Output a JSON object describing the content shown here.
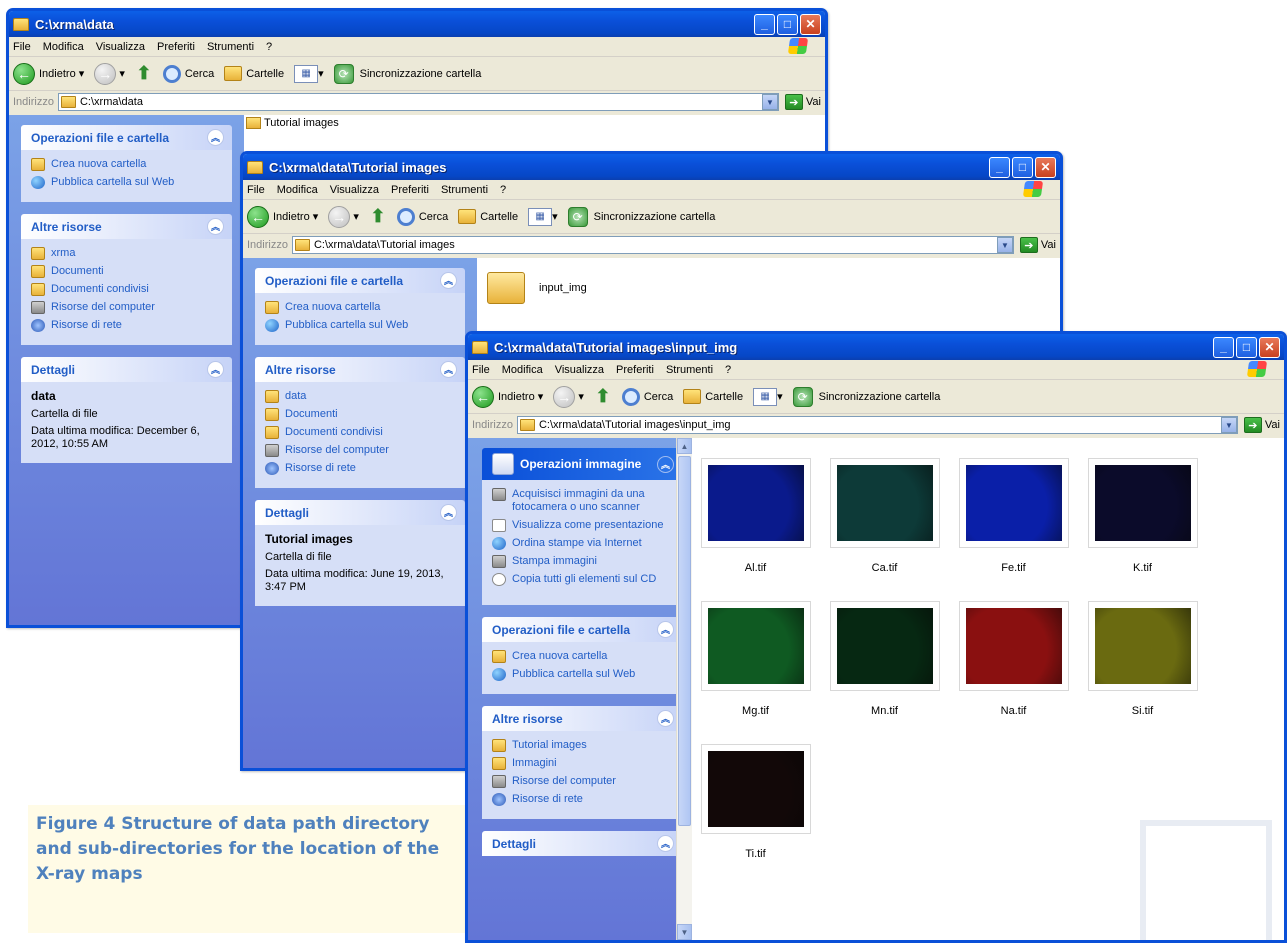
{
  "caption": "Figure 4 Structure of data path directory and sub-directories for the location of the X-ray maps",
  "menu": [
    "File",
    "Modifica",
    "Visualizza",
    "Preferiti",
    "Strumenti",
    "?"
  ],
  "toolbar": {
    "back": "Indietro",
    "search": "Cerca",
    "folders": "Cartelle",
    "sync": "Sincronizzazione cartella"
  },
  "address_label": "Indirizzo",
  "go_label": "Vai",
  "win1": {
    "title": "C:\\xrma\\data",
    "address": "C:\\xrma\\data",
    "panels": {
      "ops_title": "Operazioni file e cartella",
      "ops": [
        "Crea nuova cartella",
        "Pubblica cartella sul Web"
      ],
      "other_title": "Altre risorse",
      "other": [
        "xrma",
        "Documenti",
        "Documenti condivisi",
        "Risorse del computer",
        "Risorse di rete"
      ],
      "details_title": "Dettagli",
      "details_name": "data",
      "details_type": "Cartella di file",
      "details_date": "Data ultima modifica: December 6, 2012, 10:55 AM"
    },
    "folder_item": "Tutorial images"
  },
  "win2": {
    "title": "C:\\xrma\\data\\Tutorial images",
    "address": "C:\\xrma\\data\\Tutorial images",
    "panels": {
      "ops_title": "Operazioni file e cartella",
      "ops": [
        "Crea nuova cartella",
        "Pubblica cartella sul Web"
      ],
      "other_title": "Altre risorse",
      "other": [
        "data",
        "Documenti",
        "Documenti condivisi",
        "Risorse del computer",
        "Risorse di rete"
      ],
      "details_title": "Dettagli",
      "details_name": "Tutorial images",
      "details_type": "Cartella di file",
      "details_date": "Data ultima modifica: June 19, 2013, 3:47 PM"
    },
    "folder_item": "input_img"
  },
  "win3": {
    "title": "C:\\xrma\\data\\Tutorial images\\input_img",
    "address": "C:\\xrma\\data\\Tutorial images\\input_img",
    "panels": {
      "img_title": "Operazioni immagine",
      "img_ops": [
        "Acquisisci immagini da una fotocamera o uno scanner",
        "Visualizza come presentazione",
        "Ordina stampe via Internet",
        "Stampa immagini",
        "Copia tutti gli elementi sul CD"
      ],
      "ops_title": "Operazioni file e cartella",
      "ops": [
        "Crea nuova cartella",
        "Pubblica cartella sul Web"
      ],
      "other_title": "Altre risorse",
      "other": [
        "Tutorial images",
        "Immagini",
        "Risorse del computer",
        "Risorse di rete"
      ],
      "details_title": "Dettagli"
    },
    "files": [
      {
        "name": "Al.tif",
        "color": "#0a1a8c"
      },
      {
        "name": "Ca.tif",
        "color": "#0d3a38"
      },
      {
        "name": "Fe.tif",
        "color": "#0a1fa8"
      },
      {
        "name": "K.tif",
        "color": "#0b0b2a"
      },
      {
        "name": "Mg.tif",
        "color": "#0f5a22"
      },
      {
        "name": "Mn.tif",
        "color": "#062812"
      },
      {
        "name": "Na.tif",
        "color": "#8a1010"
      },
      {
        "name": "Si.tif",
        "color": "#6a6a10"
      },
      {
        "name": "Ti.tif",
        "color": "#120808"
      }
    ]
  }
}
